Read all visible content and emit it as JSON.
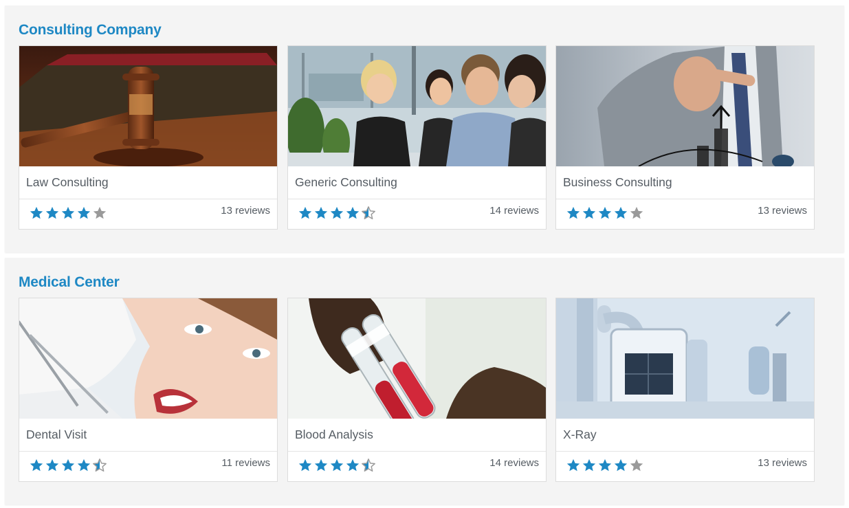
{
  "colors": {
    "accent": "#1e88c4",
    "star_filled": "#1e88c4",
    "star_empty": "#9a9a9a",
    "panel_bg": "#f4f4f4"
  },
  "sections": [
    {
      "title": "Consulting Company",
      "cards": [
        {
          "title": "Law Consulting",
          "rating": 4,
          "max_rating": 5,
          "reviews": "13 reviews",
          "image": "gavel-and-book-photo"
        },
        {
          "title": "Generic Consulting",
          "rating": 4.5,
          "max_rating": 5,
          "reviews": "14 reviews",
          "image": "business-meeting-photo"
        },
        {
          "title": "Business Consulting",
          "rating": 4,
          "max_rating": 5,
          "reviews": "13 reviews",
          "image": "businessman-growth-chart-photo"
        }
      ]
    },
    {
      "title": "Medical Center",
      "cards": [
        {
          "title": "Dental Visit",
          "rating": 4.5,
          "max_rating": 5,
          "reviews": "11 reviews",
          "image": "dental-patient-photo"
        },
        {
          "title": "Blood Analysis",
          "rating": 4.5,
          "max_rating": 5,
          "reviews": "14 reviews",
          "image": "blood-test-tubes-photo"
        },
        {
          "title": "X-Ray",
          "rating": 4,
          "max_rating": 5,
          "reviews": "13 reviews",
          "image": "xray-machine-photo"
        }
      ]
    }
  ]
}
